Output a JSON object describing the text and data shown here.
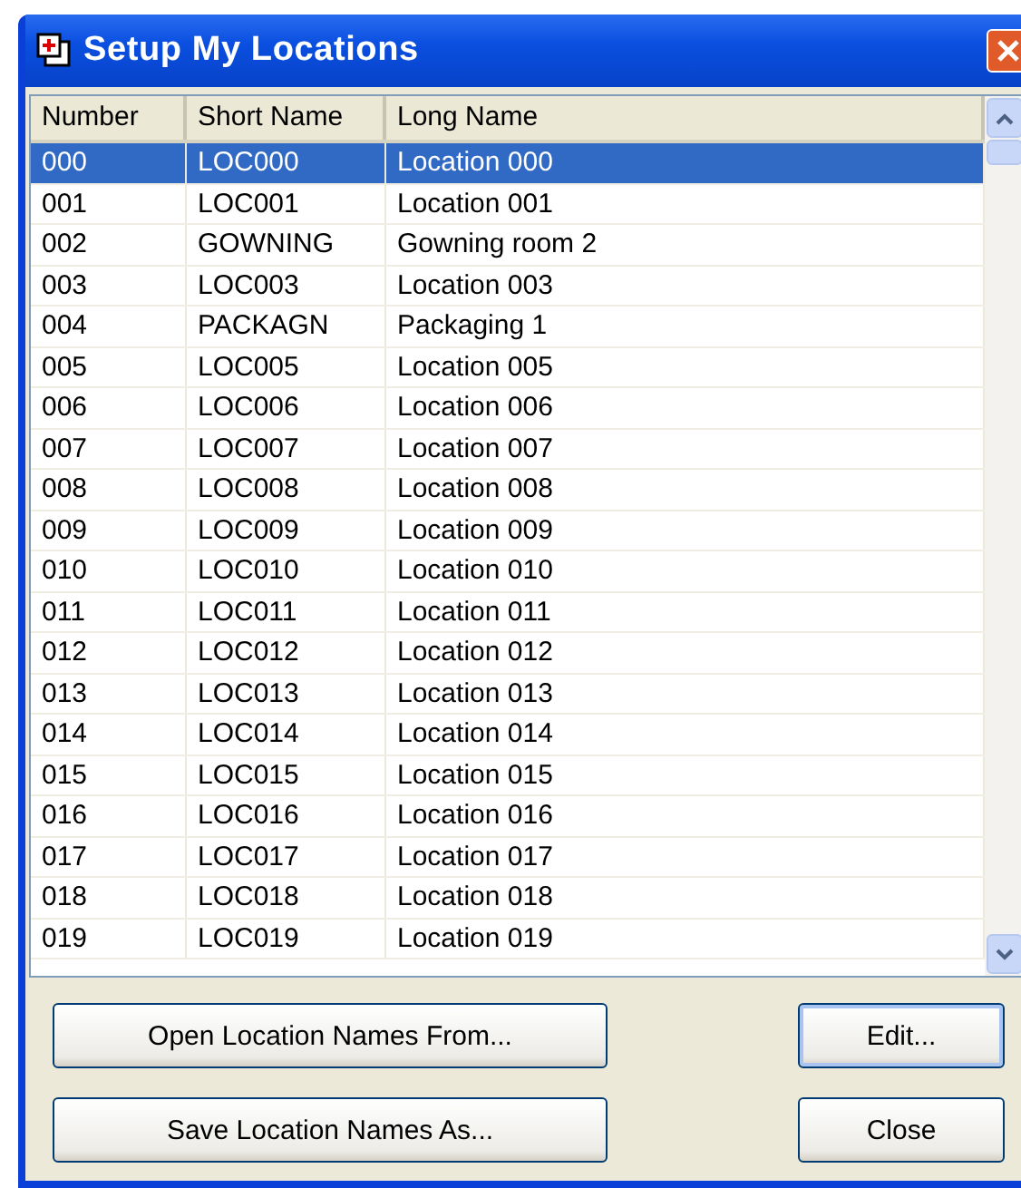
{
  "window": {
    "title": "Setup My Locations"
  },
  "table": {
    "columns": [
      "Number",
      "Short Name",
      "Long Name"
    ],
    "rows": [
      {
        "number": "000",
        "short_name": "LOC000",
        "long_name": "Location 000",
        "selected": true
      },
      {
        "number": "001",
        "short_name": "LOC001",
        "long_name": "Location 001",
        "selected": false
      },
      {
        "number": "002",
        "short_name": "GOWNING",
        "long_name": "Gowning room 2",
        "selected": false
      },
      {
        "number": "003",
        "short_name": "LOC003",
        "long_name": "Location 003",
        "selected": false
      },
      {
        "number": "004",
        "short_name": "PACKAGN",
        "long_name": "Packaging 1",
        "selected": false
      },
      {
        "number": "005",
        "short_name": "LOC005",
        "long_name": "Location 005",
        "selected": false
      },
      {
        "number": "006",
        "short_name": "LOC006",
        "long_name": "Location 006",
        "selected": false
      },
      {
        "number": "007",
        "short_name": "LOC007",
        "long_name": "Location 007",
        "selected": false
      },
      {
        "number": "008",
        "short_name": "LOC008",
        "long_name": "Location 008",
        "selected": false
      },
      {
        "number": "009",
        "short_name": "LOC009",
        "long_name": "Location 009",
        "selected": false
      },
      {
        "number": "010",
        "short_name": "LOC010",
        "long_name": "Location 010",
        "selected": false
      },
      {
        "number": "011",
        "short_name": "LOC011",
        "long_name": "Location 011",
        "selected": false
      },
      {
        "number": "012",
        "short_name": "LOC012",
        "long_name": "Location 012",
        "selected": false
      },
      {
        "number": "013",
        "short_name": "LOC013",
        "long_name": "Location 013",
        "selected": false
      },
      {
        "number": "014",
        "short_name": "LOC014",
        "long_name": "Location 014",
        "selected": false
      },
      {
        "number": "015",
        "short_name": "LOC015",
        "long_name": "Location 015",
        "selected": false
      },
      {
        "number": "016",
        "short_name": "LOC016",
        "long_name": "Location 016",
        "selected": false
      },
      {
        "number": "017",
        "short_name": "LOC017",
        "long_name": "Location 017",
        "selected": false
      },
      {
        "number": "018",
        "short_name": "LOC018",
        "long_name": "Location 018",
        "selected": false
      },
      {
        "number": "019",
        "short_name": "LOC019",
        "long_name": "Location 019",
        "selected": false
      }
    ]
  },
  "buttons": [
    {
      "label": "Open Location Names From...",
      "default": false
    },
    {
      "label": "Edit...",
      "default": true
    },
    {
      "label": "Save Location Names As...",
      "default": false
    },
    {
      "label": "Close",
      "default": false
    }
  ]
}
